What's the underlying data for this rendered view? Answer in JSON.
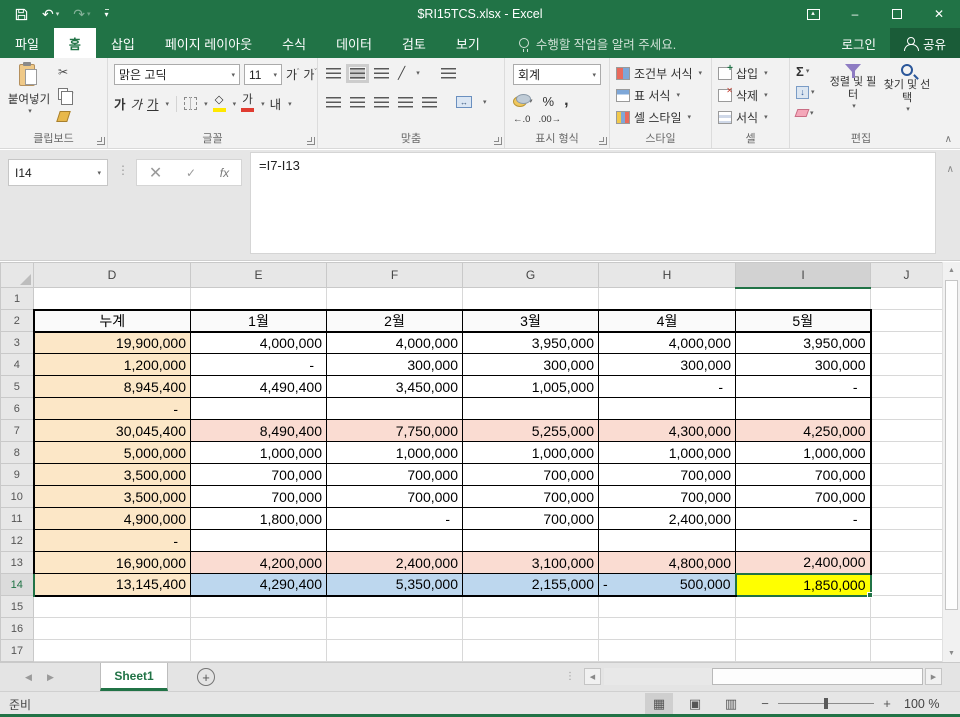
{
  "window": {
    "title": "$RI15TCS.xlsx - Excel"
  },
  "tabs": {
    "items": [
      {
        "id": "file",
        "label": "파일",
        "active": false
      },
      {
        "id": "home",
        "label": "홈",
        "active": true
      },
      {
        "id": "insert",
        "label": "삽입",
        "active": false
      },
      {
        "id": "page-layout",
        "label": "페이지 레이아웃",
        "active": false
      },
      {
        "id": "formulas",
        "label": "수식",
        "active": false
      },
      {
        "id": "data",
        "label": "데이터",
        "active": false
      },
      {
        "id": "review",
        "label": "검토",
        "active": false
      },
      {
        "id": "view",
        "label": "보기",
        "active": false
      }
    ],
    "tell_me": "수행할 작업을 알려 주세요.",
    "sign_in": "로그인",
    "share": "공유"
  },
  "ribbon": {
    "clipboard": {
      "label": "클립보드",
      "paste": "붙여넣기"
    },
    "font": {
      "label": "글꼴",
      "name": "맑은 고딕",
      "size": "11"
    },
    "alignment": {
      "label": "맞춤"
    },
    "number": {
      "label": "표시 형식",
      "format": "회계"
    },
    "styles": {
      "label": "스타일",
      "conditional": "조건부 서식",
      "format_table": "표 서식",
      "cell_styles": "셀 스타일"
    },
    "cells": {
      "label": "셀",
      "insert": "삽입",
      "delete": "삭제",
      "format": "서식"
    },
    "editing": {
      "label": "편집",
      "sort_filter": "정렬 및 필터",
      "find_select": "찾기 및 선택"
    }
  },
  "formula_bar": {
    "name_box": "I14",
    "formula": "=I7-I13"
  },
  "grid": {
    "col_headers": [
      "D",
      "E",
      "F",
      "G",
      "H",
      "I",
      "J"
    ],
    "selected_col": "I",
    "selected_row": 14,
    "rows": [
      {
        "n": 1,
        "cells": {}
      },
      {
        "n": 2,
        "cells": {
          "D": {
            "v": "누계",
            "bg": "tan"
          },
          "E": {
            "v": "1월"
          },
          "F": {
            "v": "2월"
          },
          "G": {
            "v": "3월"
          },
          "H": {
            "v": "4월"
          },
          "I": {
            "v": "5월"
          }
        }
      },
      {
        "n": 3,
        "cells": {
          "D": {
            "v": "19,900,000",
            "bg": "tan"
          },
          "E": {
            "v": "4,000,000"
          },
          "F": {
            "v": "4,000,000"
          },
          "G": {
            "v": "3,950,000"
          },
          "H": {
            "v": "4,000,000"
          },
          "I": {
            "v": "3,950,000"
          }
        }
      },
      {
        "n": 4,
        "cells": {
          "D": {
            "v": "1,200,000",
            "bg": "tan"
          },
          "E": {
            "v": "-",
            "dash": true
          },
          "F": {
            "v": "300,000"
          },
          "G": {
            "v": "300,000"
          },
          "H": {
            "v": "300,000"
          },
          "I": {
            "v": "300,000"
          }
        }
      },
      {
        "n": 5,
        "cells": {
          "D": {
            "v": "8,945,400",
            "bg": "tan"
          },
          "E": {
            "v": "4,490,400"
          },
          "F": {
            "v": "3,450,000"
          },
          "G": {
            "v": "1,005,000"
          },
          "H": {
            "v": "-",
            "dash": true
          },
          "I": {
            "v": "-",
            "dash": true
          }
        }
      },
      {
        "n": 6,
        "cells": {
          "D": {
            "v": "-",
            "bg": "tan",
            "dash": true
          }
        }
      },
      {
        "n": 7,
        "cells": {
          "D": {
            "v": "30,045,400",
            "bg": "tan"
          },
          "E": {
            "v": "8,490,400",
            "bg": "pink"
          },
          "F": {
            "v": "7,750,000",
            "bg": "pink"
          },
          "G": {
            "v": "5,255,000",
            "bg": "pink"
          },
          "H": {
            "v": "4,300,000",
            "bg": "pink"
          },
          "I": {
            "v": "4,250,000",
            "bg": "pink"
          }
        }
      },
      {
        "n": 8,
        "cells": {
          "D": {
            "v": "5,000,000",
            "bg": "tan"
          },
          "E": {
            "v": "1,000,000"
          },
          "F": {
            "v": "1,000,000"
          },
          "G": {
            "v": "1,000,000"
          },
          "H": {
            "v": "1,000,000"
          },
          "I": {
            "v": "1,000,000"
          }
        }
      },
      {
        "n": 9,
        "cells": {
          "D": {
            "v": "3,500,000",
            "bg": "tan"
          },
          "E": {
            "v": "700,000"
          },
          "F": {
            "v": "700,000"
          },
          "G": {
            "v": "700,000"
          },
          "H": {
            "v": "700,000"
          },
          "I": {
            "v": "700,000"
          }
        }
      },
      {
        "n": 10,
        "cells": {
          "D": {
            "v": "3,500,000",
            "bg": "tan"
          },
          "E": {
            "v": "700,000"
          },
          "F": {
            "v": "700,000"
          },
          "G": {
            "v": "700,000"
          },
          "H": {
            "v": "700,000"
          },
          "I": {
            "v": "700,000"
          }
        }
      },
      {
        "n": 11,
        "cells": {
          "D": {
            "v": "4,900,000",
            "bg": "tan"
          },
          "E": {
            "v": "1,800,000"
          },
          "F": {
            "v": "-",
            "dash": true
          },
          "G": {
            "v": "700,000"
          },
          "H": {
            "v": "2,400,000"
          },
          "I": {
            "v": "-",
            "dash": true
          }
        }
      },
      {
        "n": 12,
        "cells": {
          "D": {
            "v": "-",
            "bg": "tan",
            "dash": true
          }
        }
      },
      {
        "n": 13,
        "cells": {
          "D": {
            "v": "16,900,000",
            "bg": "tan"
          },
          "E": {
            "v": "4,200,000",
            "bg": "pink"
          },
          "F": {
            "v": "2,400,000",
            "bg": "pink"
          },
          "G": {
            "v": "3,100,000",
            "bg": "pink"
          },
          "H": {
            "v": "4,800,000",
            "bg": "pink"
          },
          "I": {
            "v": "2,400,000",
            "bg": "pink"
          }
        }
      },
      {
        "n": 14,
        "cells": {
          "D": {
            "v": "13,145,400",
            "bg": "tan"
          },
          "E": {
            "v": "4,290,400",
            "bg": "blue"
          },
          "F": {
            "v": "5,350,000",
            "bg": "blue"
          },
          "G": {
            "v": "2,155,000",
            "bg": "blue"
          },
          "H": {
            "v": "500,000",
            "bg": "blue",
            "neg": true
          },
          "I": {
            "v": "1,850,000",
            "bg": "yellow",
            "selected": true
          }
        }
      },
      {
        "n": 15,
        "cells": {}
      },
      {
        "n": 16,
        "cells": {}
      },
      {
        "n": 17,
        "cells": {}
      }
    ]
  },
  "sheet_tabs": {
    "active": "Sheet1"
  },
  "status": {
    "mode": "준비",
    "zoom": "100 %"
  },
  "icons": {
    "dropdown": "▾",
    "undo": "↶",
    "redo": "↷",
    "qat_more": "▾",
    "minimize": "–",
    "close": "✕",
    "collapse": "∧",
    "scissors": "✂",
    "sigma": "Σ",
    "percent": "%",
    "comma": ",",
    "inc_decimal": "←.0",
    "dec_decimal": ".00→",
    "bold": "가",
    "italic": "가",
    "underline": "가",
    "grow_font": "가",
    "shrink_font": "가",
    "phonetic": "내",
    "fill_diamond": "◇",
    "font_color": "가",
    "orientation": "╱",
    "nav_left": "◀",
    "nav_right": "▶",
    "scroll_up": "▲",
    "scroll_down": "▼",
    "new_sheet": "+",
    "view_normal": "▦",
    "view_layout": "▣",
    "view_break": "▥",
    "zoom_minus": "−",
    "zoom_plus": "+",
    "name_dots": "⋮",
    "cancel": "✕",
    "enter": "✓",
    "fx": "fx"
  },
  "colors": {
    "accent_green": "#217346",
    "header_tan": "#FCE7C7",
    "row_pink": "#FADCD2",
    "row_blue": "#BDD7EE",
    "selected_yellow": "#FFFF00"
  }
}
